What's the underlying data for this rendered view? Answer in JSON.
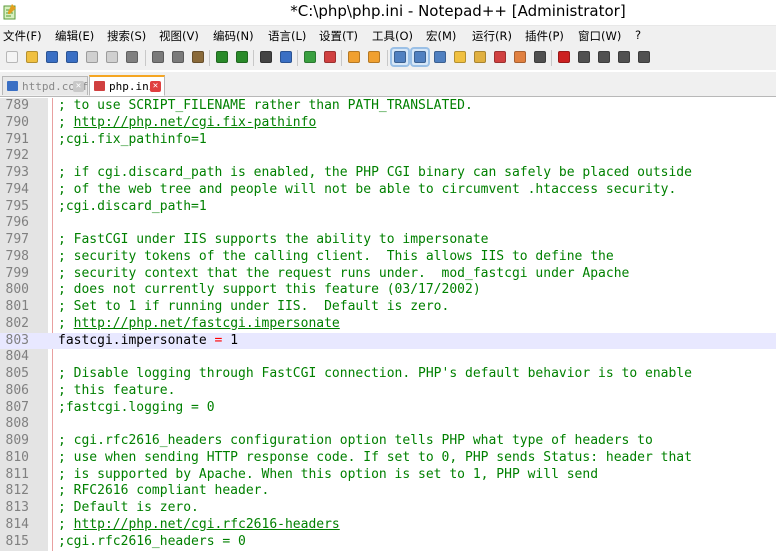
{
  "window": {
    "title": "*C:\\php\\php.ini - Notepad++ [Administrator]"
  },
  "menu": [
    {
      "label": "文件(F)"
    },
    {
      "label": "编辑(E)"
    },
    {
      "label": "搜索(S)"
    },
    {
      "label": "视图(V)"
    },
    {
      "label": "编码(N)"
    },
    {
      "label": "语言(L)"
    },
    {
      "label": "设置(T)"
    },
    {
      "label": "工具(O)"
    },
    {
      "label": "宏(M)"
    },
    {
      "label": "运行(R)"
    },
    {
      "label": "插件(P)"
    },
    {
      "label": "窗口(W)"
    },
    {
      "label": "?"
    }
  ],
  "toolbar": {
    "buttons": [
      {
        "icon": "new-file-icon",
        "color": "#f4f4f4"
      },
      {
        "icon": "open-file-icon",
        "color": "#f0c040"
      },
      {
        "icon": "save-icon",
        "color": "#3a6fc4"
      },
      {
        "icon": "save-all-icon",
        "color": "#3a6fc4"
      },
      {
        "icon": "close-icon",
        "color": "#d0d0d0"
      },
      {
        "icon": "close-all-icon",
        "color": "#d0d0d0"
      },
      {
        "icon": "print-icon",
        "color": "#808080"
      },
      {
        "icon": "cut-icon",
        "color": "#7a7a7a"
      },
      {
        "icon": "copy-icon",
        "color": "#7a7a7a"
      },
      {
        "icon": "paste-icon",
        "color": "#8a6a3a"
      },
      {
        "icon": "undo-icon",
        "color": "#2a8a2a"
      },
      {
        "icon": "redo-icon",
        "color": "#2a8a2a"
      },
      {
        "icon": "find-icon",
        "color": "#444444"
      },
      {
        "icon": "replace-icon",
        "color": "#3a6fc4"
      },
      {
        "icon": "zoom-in-icon",
        "color": "#3aa040"
      },
      {
        "icon": "zoom-out-icon",
        "color": "#d04040"
      },
      {
        "icon": "sync-vertical-icon",
        "color": "#f0a030"
      },
      {
        "icon": "sync-horizontal-icon",
        "color": "#f0a030"
      },
      {
        "icon": "word-wrap-icon",
        "color": "#5080c0"
      },
      {
        "icon": "show-all-chars-icon",
        "color": "#5080c0"
      },
      {
        "icon": "indent-guide-icon",
        "color": "#5080c0"
      },
      {
        "icon": "user-lang-icon",
        "color": "#f0c040"
      },
      {
        "icon": "doc-map-icon",
        "color": "#e0b040"
      },
      {
        "icon": "function-list-icon",
        "color": "#d04040"
      },
      {
        "icon": "folder-workspace-icon",
        "color": "#e08040"
      },
      {
        "icon": "monitoring-icon",
        "color": "#505050"
      },
      {
        "icon": "record-macro-icon",
        "color": "#cc2020"
      },
      {
        "icon": "stop-macro-icon",
        "color": "#505050"
      },
      {
        "icon": "play-macro-icon",
        "color": "#505050"
      },
      {
        "icon": "run-macro-multiple-icon",
        "color": "#505050"
      },
      {
        "icon": "save-macro-icon",
        "color": "#505050"
      }
    ]
  },
  "tabs": [
    {
      "label": "httpd.conf",
      "state": "inactive",
      "icon": "saved-file-icon",
      "color": "#3a6fc4"
    },
    {
      "label": "php.ini",
      "state": "active",
      "icon": "modified-file-icon",
      "color": "#d04040"
    }
  ],
  "editor": {
    "lines": [
      {
        "num": "789",
        "text": "; to use SCRIPT_FILENAME rather than PATH_TRANSLATED."
      },
      {
        "num": "790",
        "pre": "; ",
        "link": "http://php.net/cgi.fix-pathinfo"
      },
      {
        "num": "791",
        "text": ";cgi.fix_pathinfo=1"
      },
      {
        "num": "792",
        "text": ""
      },
      {
        "num": "793",
        "text": "; if cgi.discard_path is enabled, the PHP CGI binary can safely be placed outside"
      },
      {
        "num": "794",
        "text": "; of the web tree and people will not be able to circumvent .htaccess security."
      },
      {
        "num": "795",
        "text": ";cgi.discard_path=1"
      },
      {
        "num": "796",
        "text": ""
      },
      {
        "num": "797",
        "text": "; FastCGI under IIS supports the ability to impersonate"
      },
      {
        "num": "798",
        "text": "; security tokens of the calling client.  This allows IIS to define the"
      },
      {
        "num": "799",
        "text": "; security context that the request runs under.  mod_fastcgi under Apache"
      },
      {
        "num": "800",
        "text": "; does not currently support this feature (03/17/2002)"
      },
      {
        "num": "801",
        "text": "; Set to 1 if running under IIS.  Default is zero."
      },
      {
        "num": "802",
        "pre": "; ",
        "link": "http://php.net/fastcgi.impersonate"
      },
      {
        "num": "803",
        "key": "fastcgi.impersonate",
        "op": "=",
        "val": "1",
        "current": true
      },
      {
        "num": "804",
        "text": ""
      },
      {
        "num": "805",
        "text": "; Disable logging through FastCGI connection. PHP's default behavior is to enable"
      },
      {
        "num": "806",
        "text": "; this feature."
      },
      {
        "num": "807",
        "text": ";fastcgi.logging = 0"
      },
      {
        "num": "808",
        "text": ""
      },
      {
        "num": "809",
        "text": "; cgi.rfc2616_headers configuration option tells PHP what type of headers to"
      },
      {
        "num": "810",
        "text": "; use when sending HTTP response code. If set to 0, PHP sends Status: header that"
      },
      {
        "num": "811",
        "text": "; is supported by Apache. When this option is set to 1, PHP will send"
      },
      {
        "num": "812",
        "text": "; RFC2616 compliant header."
      },
      {
        "num": "813",
        "text": "; Default is zero."
      },
      {
        "num": "814",
        "pre": "; ",
        "link": "http://php.net/cgi.rfc2616-headers"
      },
      {
        "num": "815",
        "text": ";cgi.rfc2616_headers = 0"
      }
    ]
  }
}
